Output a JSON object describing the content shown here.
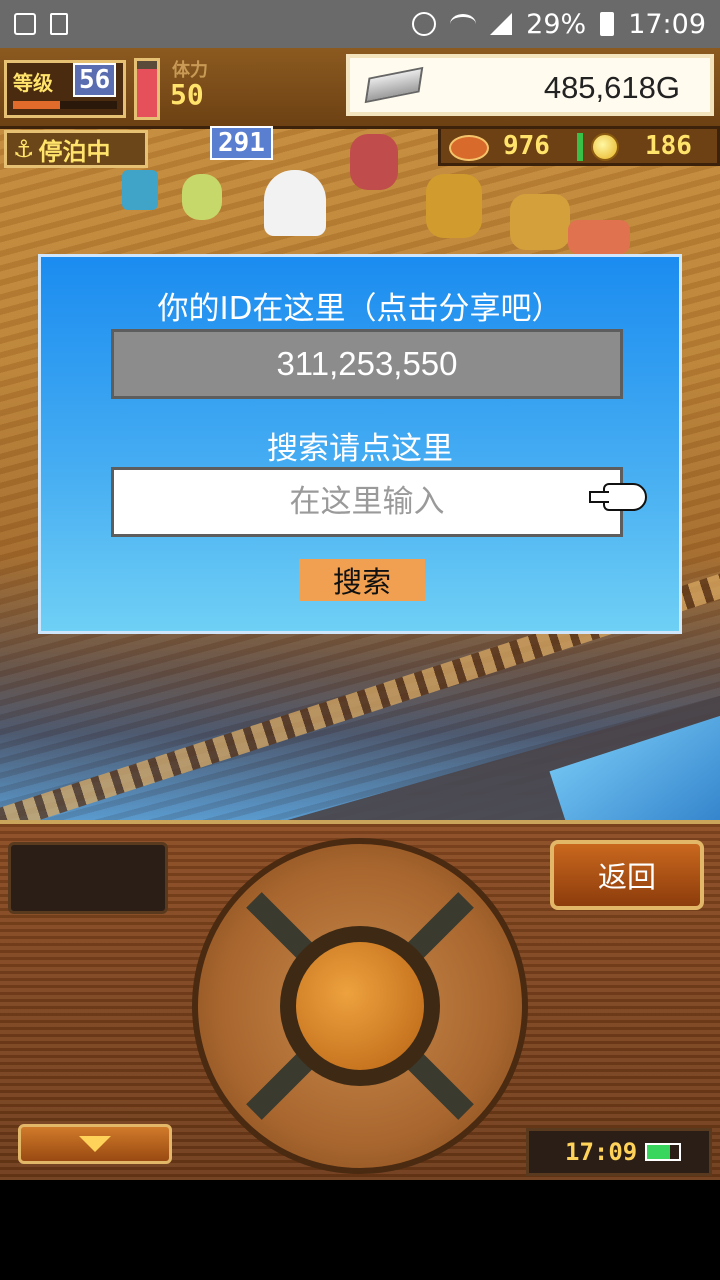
{
  "status_bar": {
    "battery_percent": "29%",
    "time": "17:09",
    "icons": [
      "gallery-icon",
      "recycle-icon",
      "alarm-icon",
      "wifi-icon",
      "signal-icon",
      "battery-icon"
    ]
  },
  "hud": {
    "level_label": "等级",
    "level_value": "56",
    "level_progress": 0.45,
    "stamina_label": "体力",
    "stamina_value": "50",
    "stamina_fill": 0.85,
    "money": "485,618G",
    "status_label": "停泊中",
    "counter": "291",
    "resource_1": "976",
    "resource_2": "186"
  },
  "dialog": {
    "title": "你的ID在这里（点击分享吧）",
    "id_value": "311,253,550",
    "search_hint": "搜索请点这里",
    "search_placeholder": "在这里输入",
    "search_button": "搜索"
  },
  "panel": {
    "back_button": "返回",
    "clock": "17:09",
    "battery_level": 0.7
  },
  "colors": {
    "dialog_top": "#1b8cf0",
    "dialog_bottom": "#6fd0f5",
    "search_button": "#f0a050",
    "id_field": "#8c8c8c"
  }
}
